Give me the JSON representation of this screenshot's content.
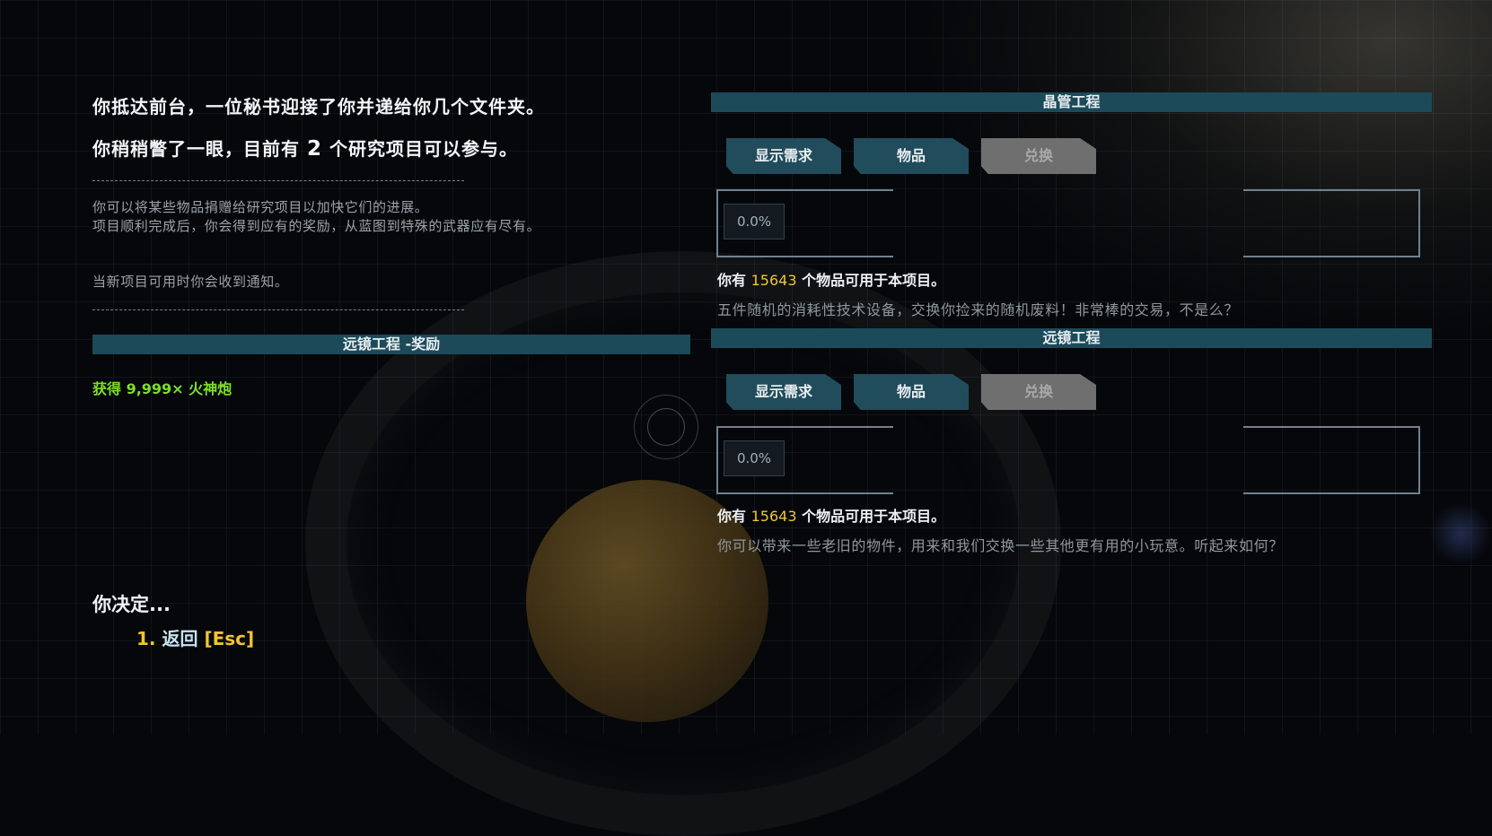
{
  "intro": {
    "line1": "你抵达前台，一位秘书迎接了你并递给你几个文件夹。",
    "line2_prefix": "你稍稍瞥了一眼，目前有",
    "line2_count": "2",
    "line2_suffix": "个研究项目可以参与。",
    "note1": "你可以将某些物品捐赠给研究项目以加快它们的进展。",
    "note2": "项目顺利完成后，你会得到应有的奖励，从蓝图到特殊的武器应有尽有。",
    "note3": "当新项目可用时你会收到通知。"
  },
  "reward": {
    "banner": "远镜工程 -奖励",
    "text": "获得 9,999× 火神炮"
  },
  "decision": {
    "prompt": "你决定...",
    "option_number": "1.",
    "option_label": "返回",
    "option_key": "[Esc]"
  },
  "projects": [
    {
      "title": "晶管工程",
      "tabs": [
        "显示需求",
        "物品",
        "兑换"
      ],
      "progress": "0.0%",
      "progress_value": 0.0,
      "have_prefix": "你有",
      "have_count": "15643",
      "have_suffix": "个物品可用于本项目。",
      "description": "五件随机的消耗性技术设备，交换你捡来的随机废料！非常棒的交易，不是么？"
    },
    {
      "title": "远镜工程",
      "tabs": [
        "显示需求",
        "物品",
        "兑换"
      ],
      "progress": "0.0%",
      "progress_value": 0.0,
      "have_prefix": "你有",
      "have_count": "15643",
      "have_suffix": "个物品可用于本项目。",
      "description": "你可以带来一些老旧的物件，用来和我们交换一些其他更有用的小玩意。听起来如何？"
    }
  ],
  "colors": {
    "banner": "#1c4a59",
    "tab": "#214c5b",
    "tab_disabled": "#6f6f6f",
    "highlight": "#f2c531",
    "reward": "#7ee02a"
  }
}
